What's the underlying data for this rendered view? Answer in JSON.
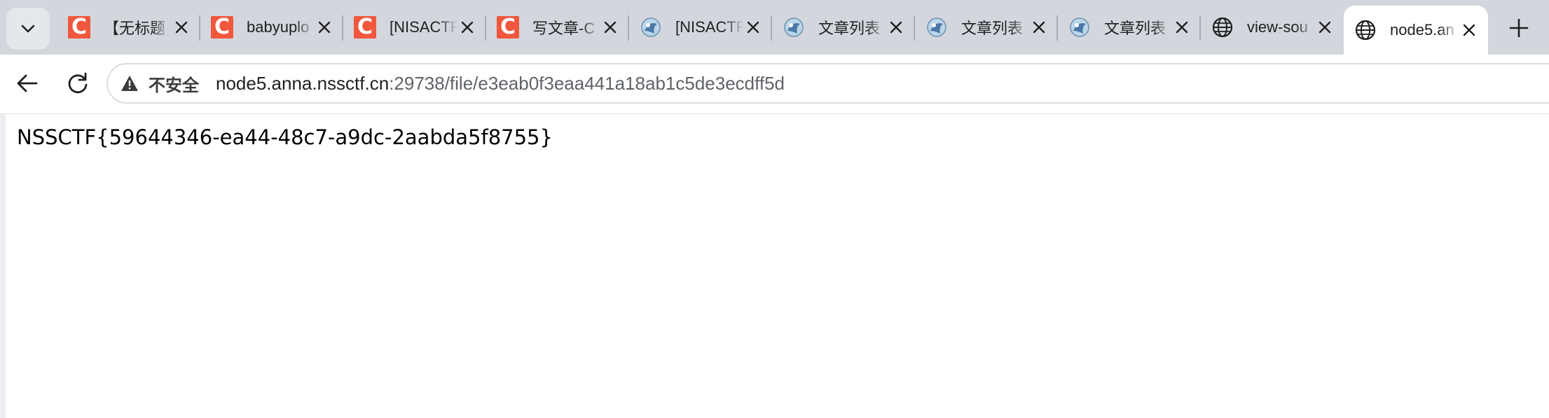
{
  "tabs": [
    {
      "title": "【无标题",
      "favicon": "csdn-c-icon"
    },
    {
      "title": "babyuplo",
      "favicon": "csdn-c-icon"
    },
    {
      "title": "[NISACTF",
      "favicon": "csdn-c-icon"
    },
    {
      "title": "写文章-C",
      "favicon": "csdn-c-icon"
    },
    {
      "title": "[NISACTF",
      "favicon": "nssctf-icon"
    },
    {
      "title": "文章列表",
      "favicon": "nssctf-icon"
    },
    {
      "title": "文章列表",
      "favicon": "nssctf-icon"
    },
    {
      "title": "文章列表",
      "favicon": "nssctf-icon"
    },
    {
      "title": "view-sou",
      "favicon": "globe-icon"
    },
    {
      "title": "node5.an",
      "favicon": "globe-icon",
      "active": true
    }
  ],
  "favicon_letter": "C",
  "toolbar": {
    "security_label": "不安全",
    "url_host": "node5.anna.nssctf.cn",
    "url_rest": ":29738/file/e3eab0f3eaa441a18ab1c5de3ecdff5d"
  },
  "page": {
    "body_text": "NSSCTF{59644346-ea44-48c7-a9dc-2aabda5f8755}"
  },
  "colors": {
    "tabstrip_bg": "#d3d7dd",
    "csdn_red": "#f0573c"
  }
}
